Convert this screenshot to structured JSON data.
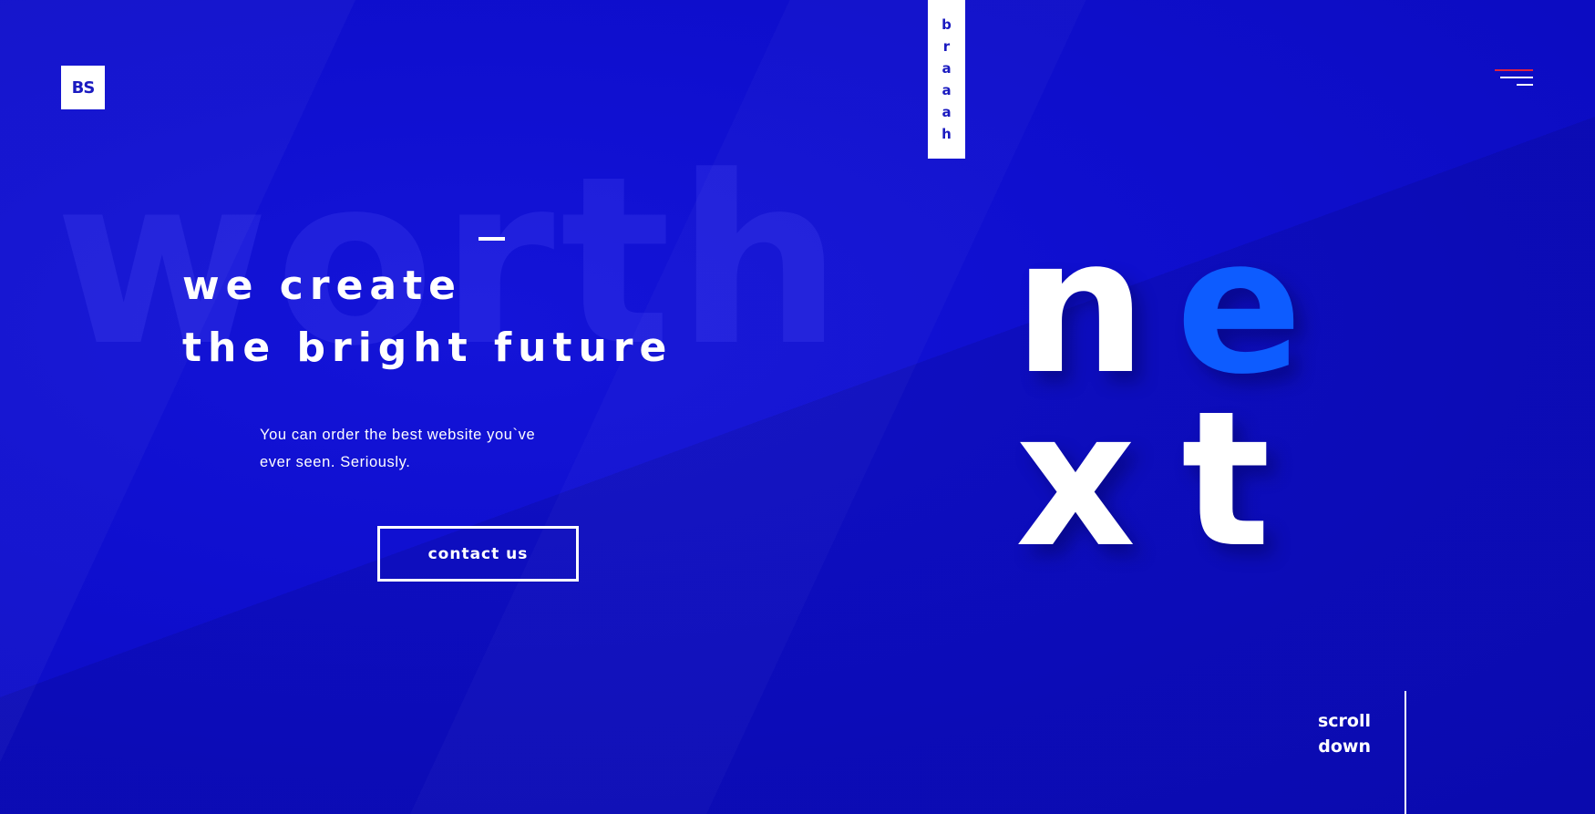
{
  "logo": {
    "text": "BS"
  },
  "vertical_tag": {
    "letters": [
      "b",
      "r",
      "a",
      "a",
      "a",
      "h"
    ]
  },
  "menu": {
    "icon": "hamburger-menu-icon",
    "accent_color": "#e0213f"
  },
  "background": {
    "word": "worth",
    "color": "#1010cc"
  },
  "hero": {
    "headline_line1": "we create",
    "headline_line2": "the bright future",
    "subtext_line1": "You can order the best website you`ve",
    "subtext_line2": "ever seen. Seriously.",
    "cta_label": "contact us"
  },
  "next_word": {
    "letters": [
      "n",
      "e",
      "x",
      "t"
    ],
    "accent_color": "#0d5cff"
  },
  "scroll": {
    "line1": "scroll",
    "line2": "down"
  }
}
